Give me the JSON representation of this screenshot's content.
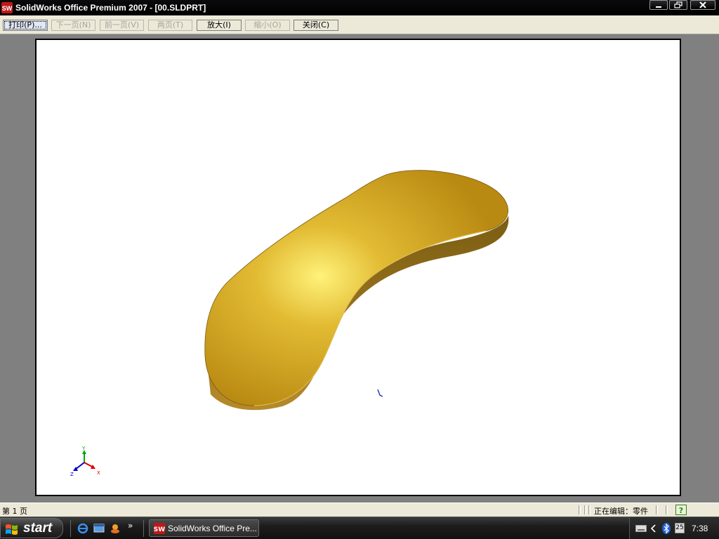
{
  "window": {
    "title": "SolidWorks Office Premium 2007 - [00.SLDPRT]",
    "app_icon_text": "SW"
  },
  "toolbar": {
    "print_label": "打印(P)...",
    "next_page_label": "下一页(N)",
    "prev_page_label": "前一页(V)",
    "two_pages_label": "两页(T)",
    "zoom_in_label": "放大(I)",
    "zoom_out_label": "缩小(O)",
    "close_label": "关闭(C)"
  },
  "preview": {
    "model": "curved-part-3d",
    "model_color": "#d3a92a",
    "triad_labels": {
      "x": "X",
      "y": "Y",
      "z": "Z"
    }
  },
  "status": {
    "page": "第 1 页",
    "mode": "正在编辑：零件",
    "help_icon": "help-icon"
  },
  "taskbar": {
    "start_label": "start",
    "task_label": "SolidWorks Office Pre...",
    "more_label": "»",
    "calendar_day": "25",
    "clock": "7:38"
  }
}
